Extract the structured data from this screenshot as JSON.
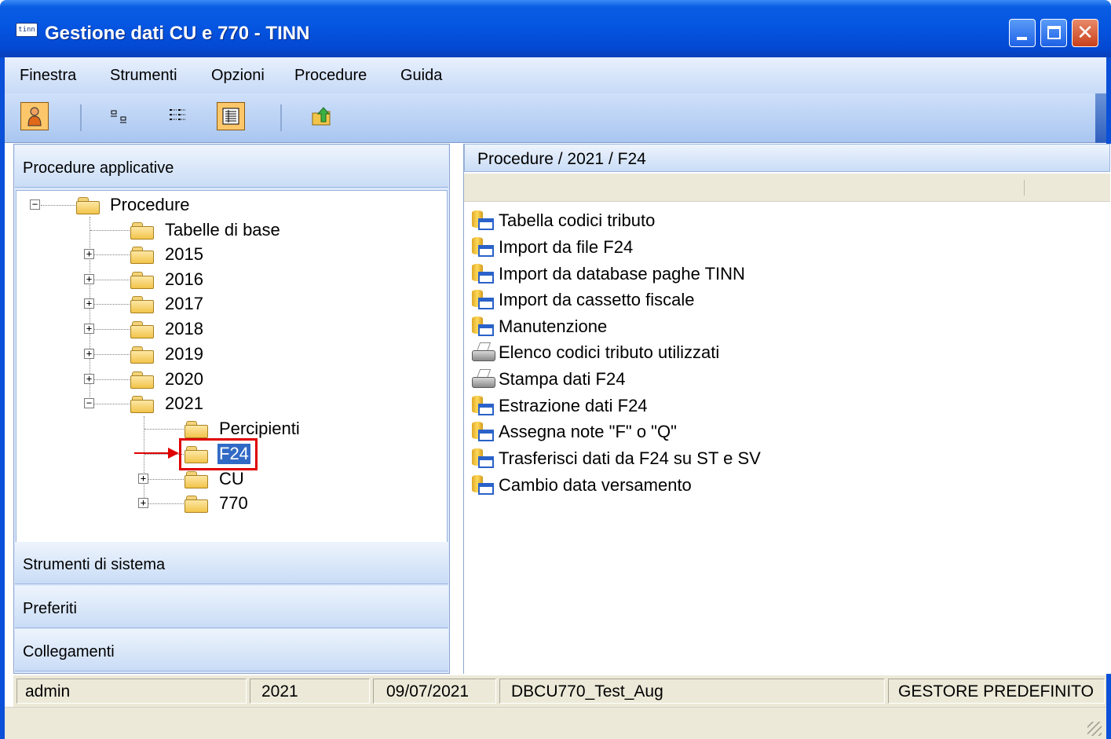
{
  "window": {
    "title": "Gestione dati CU e 770 - TINN",
    "app_icon": "tinn",
    "controls": [
      "minimize",
      "maximize",
      "close"
    ]
  },
  "menu": [
    "Finestra",
    "Strumenti",
    "Opzioni",
    "Procedure",
    "Guida"
  ],
  "toolbar": {
    "buttons": [
      {
        "icon": "user-icon",
        "active": true
      },
      {
        "icon": "small-icons-view-icon",
        "active": false
      },
      {
        "icon": "list-view-icon",
        "active": false
      },
      {
        "icon": "details-view-icon",
        "active": true
      },
      {
        "icon": "folder-up-icon",
        "active": false
      }
    ]
  },
  "left_pane": {
    "sections": [
      "Procedure applicative",
      "Strumenti di sistema",
      "Preferiti",
      "Collegamenti"
    ],
    "tree": {
      "root": "Procedure",
      "children": [
        {
          "label": "Tabelle di base",
          "expandable": false
        },
        {
          "label": "2015",
          "expandable": true
        },
        {
          "label": "2016",
          "expandable": true
        },
        {
          "label": "2017",
          "expandable": true
        },
        {
          "label": "2018",
          "expandable": true
        },
        {
          "label": "2019",
          "expandable": true
        },
        {
          "label": "2020",
          "expandable": true
        },
        {
          "label": "2021",
          "expandable": true,
          "expanded": true,
          "children": [
            {
              "label": "Percipienti",
              "expandable": false
            },
            {
              "label": "F24",
              "expandable": false,
              "selected": true
            },
            {
              "label": "CU",
              "expandable": true
            },
            {
              "label": "770",
              "expandable": true
            }
          ]
        }
      ]
    }
  },
  "right_pane": {
    "breadcrumb": "Procedure / 2021 / F24",
    "items": [
      {
        "label": "Tabella codici tributo",
        "icon": "procedure-icon"
      },
      {
        "label": "Import da file F24",
        "icon": "procedure-icon"
      },
      {
        "label": "Import da database paghe TINN",
        "icon": "procedure-icon"
      },
      {
        "label": "Import da cassetto fiscale",
        "icon": "procedure-icon"
      },
      {
        "label": "Manutenzione",
        "icon": "procedure-icon"
      },
      {
        "label": "Elenco codici tributo utilizzati",
        "icon": "printer-icon"
      },
      {
        "label": "Stampa dati F24",
        "icon": "printer-icon"
      },
      {
        "label": "Estrazione dati F24",
        "icon": "procedure-icon"
      },
      {
        "label": "Assegna note \"F\" o \"Q\"",
        "icon": "procedure-icon"
      },
      {
        "label": "Trasferisci dati da F24 su ST e SV",
        "icon": "procedure-icon"
      },
      {
        "label": "Cambio data versamento",
        "icon": "procedure-icon"
      }
    ]
  },
  "statusbar": {
    "user": "admin",
    "year": "2021",
    "date": "09/07/2021",
    "database": "DBCU770_Test_Aug",
    "manager": "GESTORE PREDEFINITO"
  }
}
